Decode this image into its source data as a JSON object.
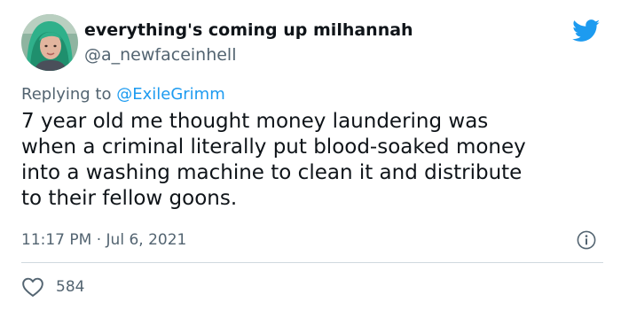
{
  "author": {
    "display_name": "everything's coming up milhannah",
    "handle": "@a_newfaceinhell",
    "avatar_icon": "profile-photo"
  },
  "brand": {
    "icon": "twitter-bird-icon",
    "color": "#1d9bf0"
  },
  "reply": {
    "prefix": "Replying to",
    "mention": "@ExileGrimm"
  },
  "tweet": {
    "text": "7 year old me thought money laundering was\nwhen a criminal literally put blood-soaked money\ninto a washing machine to clean it and distribute\nto their fellow goons.",
    "timestamp": "11:17 PM · Jul 6, 2021"
  },
  "actions": {
    "like_count": "584",
    "like_icon": "heart-icon",
    "info_icon": "info-icon"
  },
  "colors": {
    "text_primary": "#0f1419",
    "text_secondary": "#536471",
    "divider": "#cfd9de"
  }
}
